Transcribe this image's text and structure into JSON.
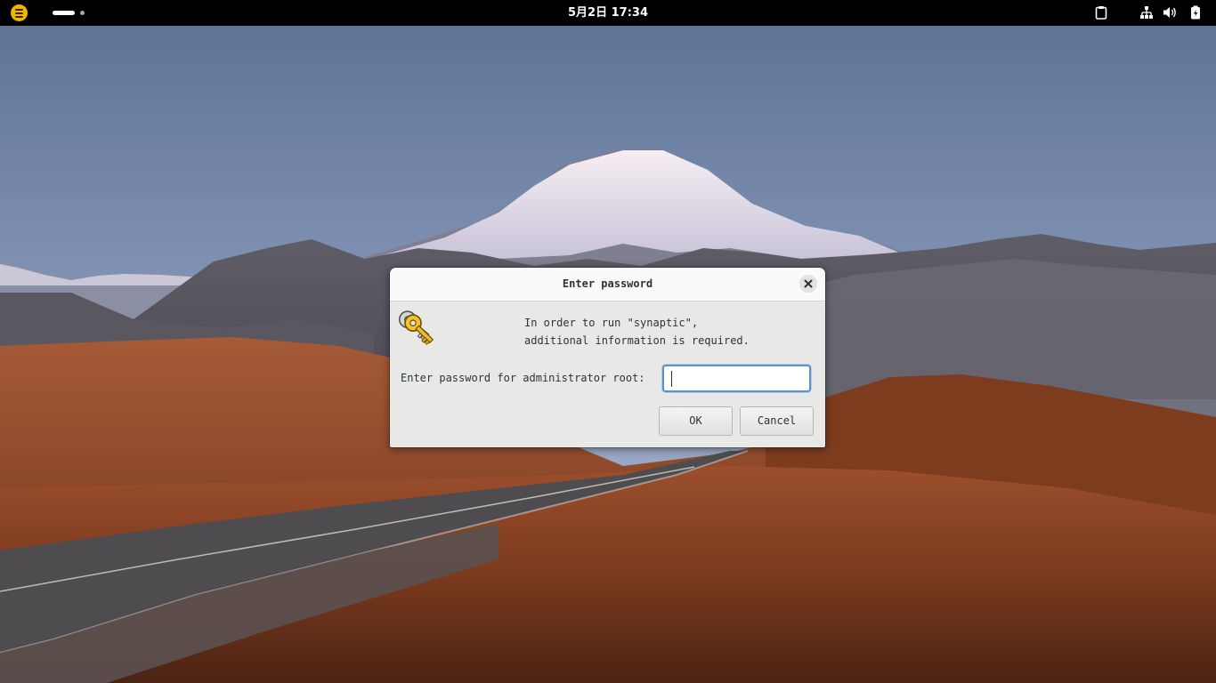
{
  "topbar": {
    "clock": "5月2日 17:34",
    "icons": [
      "activities-icon",
      "workspace-indicator",
      "clipboard-icon",
      "network-icon",
      "volume-icon",
      "battery-icon"
    ]
  },
  "dialog": {
    "title": "Enter password",
    "message_line1": "In order to run \"synaptic\",",
    "message_line2": "additional information is required.",
    "password_label": "Enter password for administrator root:",
    "password_value": "",
    "ok_label": "OK",
    "cancel_label": "Cancel",
    "icon": "keys-icon"
  },
  "colors": {
    "accent": "#5a92d6",
    "activities": "#f1b400",
    "topbar": "#000000"
  }
}
